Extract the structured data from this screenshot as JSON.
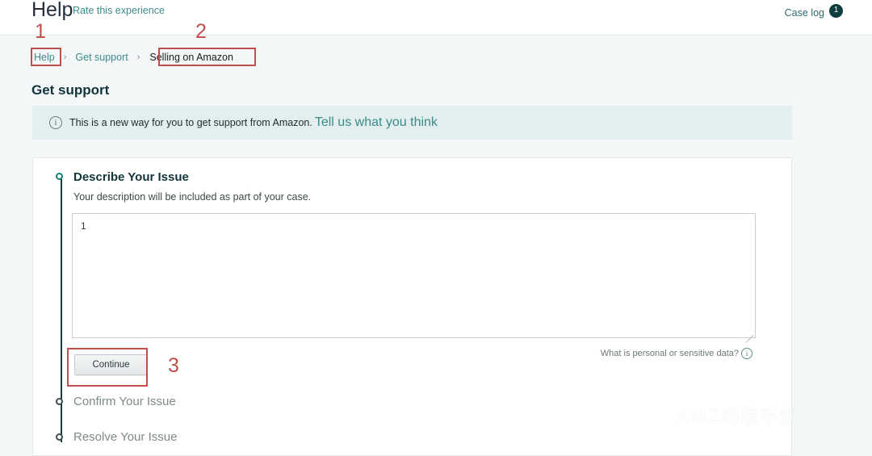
{
  "header": {
    "title": "Help",
    "rate_link": "Rate this experience",
    "case_log_label": "Case log",
    "case_log_count": "1"
  },
  "breadcrumb": {
    "items": [
      {
        "label": "Help",
        "current": false
      },
      {
        "label": "Get support",
        "current": false
      },
      {
        "label": "Selling on Amazon",
        "current": true
      }
    ],
    "separator": "›"
  },
  "page": {
    "title": "Get support"
  },
  "banner": {
    "icon": "info-circle-icon",
    "text": "This is a new way for you to get support from Amazon.",
    "link": "Tell us what you think"
  },
  "steps": [
    {
      "title": "Describe Your Issue",
      "subtitle": "Your description will be included as part of your case.",
      "state": "active"
    },
    {
      "title": "Confirm Your Issue",
      "state": "pending"
    },
    {
      "title": "Resolve Your Issue",
      "state": "pending"
    }
  ],
  "form": {
    "textarea_value": "1",
    "textarea_placeholder": "",
    "sensitive_data_link": "What is personal or sensitive data?",
    "sensitive_data_icon": "info-circle-icon",
    "continue_label": "Continue"
  },
  "annotations": [
    {
      "number": "1",
      "target": "breadcrumb-help"
    },
    {
      "number": "2",
      "target": "breadcrumb-selling-on-amazon"
    },
    {
      "number": "3",
      "target": "continue-button"
    }
  ],
  "watermark": {
    "text": "AMZ跨境不求人",
    "icon": "wechat-icon"
  },
  "colors": {
    "page_background": "#f4f7f8",
    "card_background": "#ffffff",
    "banner_background": "#e3efee",
    "link_teal": "#3c8a89",
    "heading_dark": "#12343b",
    "annotation_red": "#bf4f4c",
    "badge_dark": "#0f3e3e",
    "step_active": "#17807d"
  }
}
